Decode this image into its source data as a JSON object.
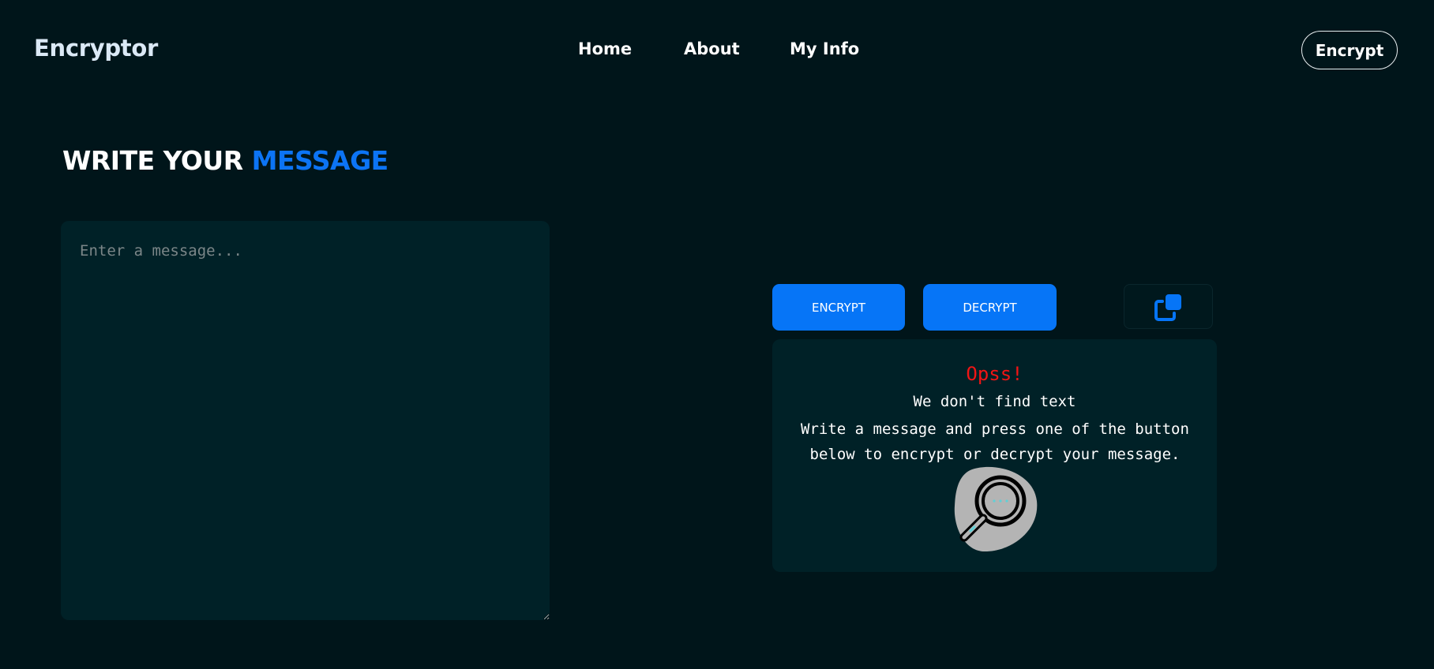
{
  "app": {
    "logo": "Encryptor"
  },
  "nav": {
    "items": [
      {
        "label": "Home"
      },
      {
        "label": "About"
      },
      {
        "label": "My Info"
      }
    ],
    "cta_label": "Encrypt"
  },
  "heading": {
    "text": "WRITE YOUR",
    "accent": "MESSAGE"
  },
  "input": {
    "value": "",
    "placeholder": "Enter a message..."
  },
  "actions": {
    "encrypt_label": "ENCRYPT",
    "decrypt_label": "DECRYPT",
    "copy_icon": "copy-icon"
  },
  "output": {
    "title": "Opss!",
    "subtitle": "We don't find text",
    "description": "Write a message and press one of the button below to encrypt or decrypt your message.",
    "illustration": "magnifier-icon"
  },
  "colors": {
    "background": "#00151a",
    "panel": "#002127",
    "accent": "#0675f7",
    "error": "#f01515"
  }
}
